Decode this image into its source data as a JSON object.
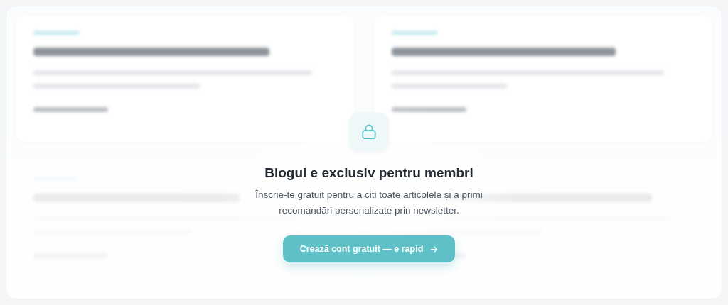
{
  "gate": {
    "title": "Blogul e exclusiv pentru membri",
    "text": "Înscrie-te gratuit pentru a citi toate articolele și a primi recomandări personalizate prin newsletter.",
    "button": "Crează cont gratuit — e rapid"
  }
}
